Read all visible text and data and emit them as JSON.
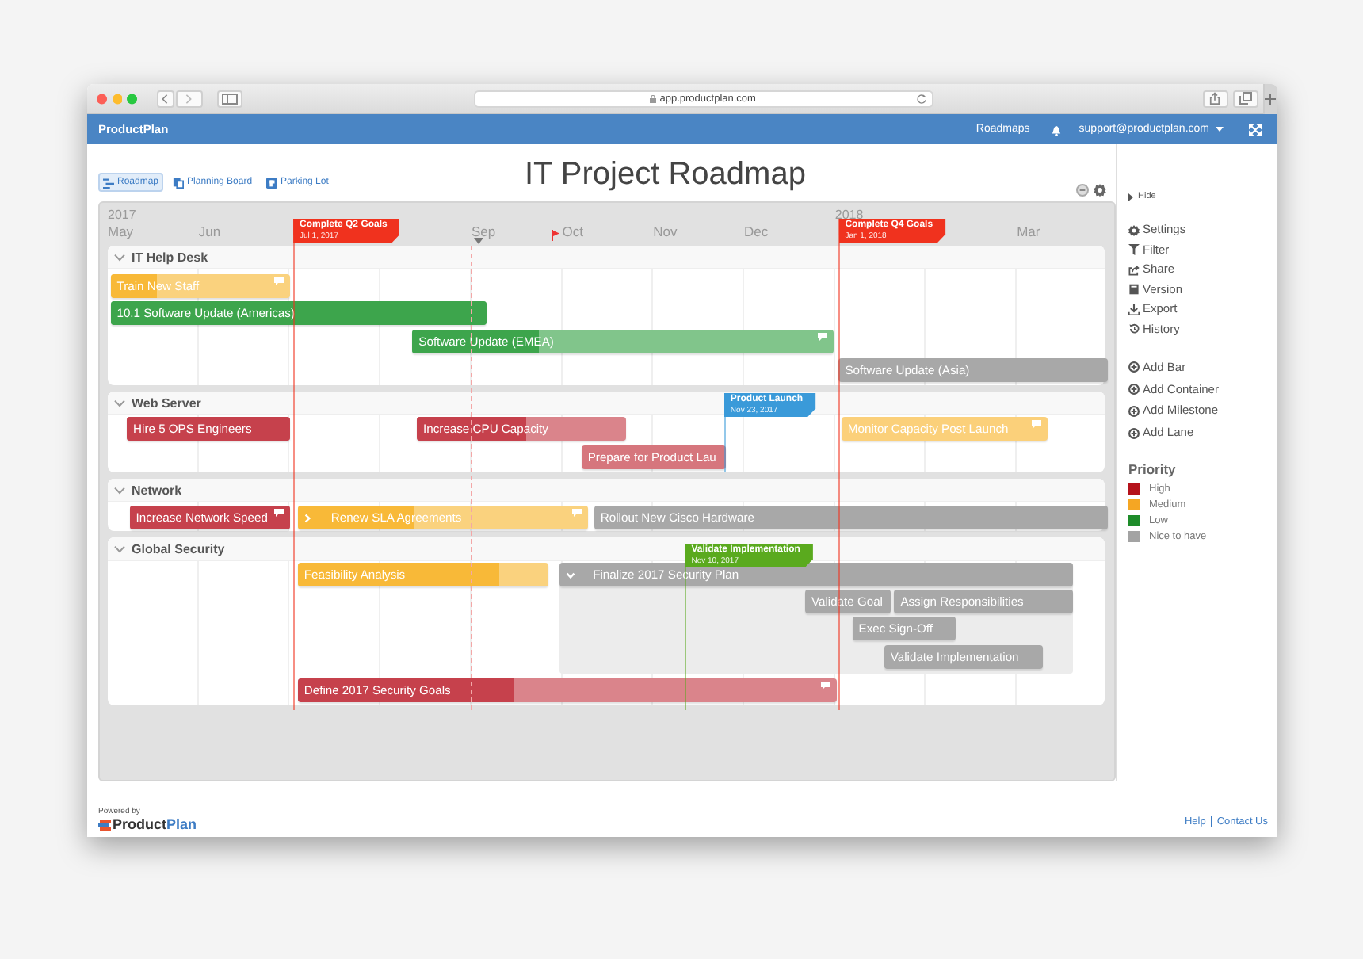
{
  "browser": {
    "url": "app.productplan.com"
  },
  "header": {
    "brand": "ProductPlan",
    "nav": "Roadmaps",
    "account": "support@productplan.com"
  },
  "views": [
    {
      "label": "Roadmap",
      "kind": "roadmap",
      "selected": true
    },
    {
      "label": "Planning Board",
      "kind": "board",
      "selected": false
    },
    {
      "label": "Parking Lot",
      "kind": "parking",
      "selected": false
    }
  ],
  "title": "IT Project Roadmap",
  "timeline": {
    "years": [
      "2017",
      "2018"
    ],
    "months": [
      "May",
      "Jun",
      "Sep",
      "Oct",
      "Nov",
      "Dec",
      "Mar"
    ]
  },
  "milestones": [
    {
      "title": "Complete Q2 Goals",
      "date": "Jul 1, 2017",
      "color": "#f0321e"
    },
    {
      "title": "Complete Q4 Goals",
      "date": "Jan 1, 2018",
      "color": "#f0321e"
    },
    {
      "title": "Product Launch",
      "date": "Nov 23, 2017",
      "color": "#3a9ad9"
    },
    {
      "title": "Validate Implementation",
      "date": "Nov 10, 2017",
      "color": "#5aaa1e"
    }
  ],
  "lanes": [
    {
      "name": "IT Help Desk",
      "expanded": true,
      "bars": [
        {
          "label": "Train New Staff",
          "kind": "bar",
          "color": "#f8b938",
          "level": 0.26,
          "comment": true
        },
        {
          "label": "10.1 Software Update (Americas)",
          "kind": "bar",
          "color": "#3da54c",
          "level": 1,
          "comment": false
        },
        {
          "label": "Software Update (EMEA)",
          "kind": "bar",
          "color": "#3da54c",
          "level": 0.3,
          "comment": true
        },
        {
          "label": "Software Update (Asia)",
          "kind": "bar",
          "color": "#a8a8a8",
          "comment": false
        }
      ]
    },
    {
      "name": "Web Server",
      "expanded": true,
      "bars": [
        {
          "label": "Hire 5 OPS Engineers",
          "kind": "bar",
          "color": "#c6414c",
          "level": 1,
          "comment": false
        },
        {
          "label": "Increase CPU Capacity",
          "kind": "bar",
          "color": "#c6414c",
          "level": 0.52,
          "comment": false
        },
        {
          "label": "Prepare for Product Lau",
          "kind": "bar",
          "color": "#d6767d",
          "comment": false
        },
        {
          "label": "Monitor Capacity Post Launch",
          "kind": "bar",
          "color": "#fbd07a",
          "comment": true
        }
      ]
    },
    {
      "name": "Network",
      "expanded": true,
      "bars": [
        {
          "label": "Increase Network Speed",
          "kind": "bar",
          "color": "#c6414c",
          "level": 1,
          "comment": true
        },
        {
          "label": "Renew SLA Agreements",
          "kind": "container",
          "expanded": false,
          "color": "#f8b938",
          "level": 0.4,
          "comment": true
        },
        {
          "label": "Rollout New Cisco Hardware",
          "kind": "bar",
          "color": "#a8a8a8",
          "comment": false
        }
      ]
    },
    {
      "name": "Global Security",
      "expanded": true,
      "bars": [
        {
          "label": "Feasibility Analysis",
          "kind": "bar",
          "color": "#f8b938",
          "level": 0.8,
          "comment": false
        },
        {
          "label": "Finalize 2017 Security Plan",
          "kind": "container",
          "expanded": true,
          "color": "#a8a8a8",
          "comment": false,
          "children": [
            {
              "label": "Validate Goal",
              "color": "#a8a8a8",
              "comment": false
            },
            {
              "label": "Assign Responsibilities",
              "color": "#a8a8a8",
              "comment": false
            },
            {
              "label": "Exec Sign-Off",
              "color": "#a8a8a8",
              "comment": false
            },
            {
              "label": "Validate Implementation",
              "color": "#a8a8a8",
              "comment": false
            }
          ]
        },
        {
          "label": "Define 2017 Security Goals",
          "kind": "bar",
          "color": "#c6414c",
          "level": 0.4,
          "comment": true
        }
      ]
    }
  ],
  "sidebar": {
    "hide": "Hide",
    "actions": [
      {
        "label": "Settings",
        "kind": "settings"
      },
      {
        "label": "Filter",
        "kind": "filter"
      },
      {
        "label": "Share",
        "kind": "share"
      },
      {
        "label": "Version",
        "kind": "version"
      },
      {
        "label": "Export",
        "kind": "export"
      },
      {
        "label": "History",
        "kind": "history"
      }
    ],
    "add_actions": [
      "Add Bar",
      "Add Container",
      "Add Milestone",
      "Add Lane"
    ],
    "legend_title": "Priority",
    "legend": [
      {
        "label": "High",
        "color": "#b5121b"
      },
      {
        "label": "Medium",
        "color": "#f5a623"
      },
      {
        "label": "Low",
        "color": "#1e8c2a"
      },
      {
        "label": "Nice to have",
        "color": "#a3a3a3"
      }
    ]
  },
  "footer": {
    "powered_by": "Powered by",
    "logo_first": "Product",
    "logo_second": "Plan",
    "links": [
      "Help",
      "Contact Us"
    ]
  }
}
